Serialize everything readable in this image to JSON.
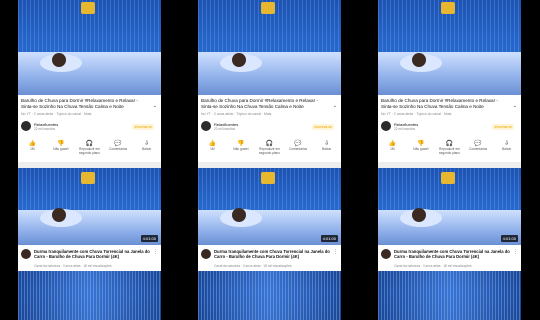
{
  "panels": [
    {
      "video1": {
        "title": "Barulho de Chuva para Dormir #Relaxamento e Relaxar - Sinta-se Sozinho Na Chuva Tensão Calma e Noite",
        "meta": "No YT · 2 anos atrás · Tópico do canal · Mais",
        "channel": "Relaxfluentes",
        "subs": "22 mil inscritos",
        "subscribe": "Inscreva-se"
      },
      "actions": [
        {
          "icon": "like-icon",
          "glyph": "👍",
          "label": "1M"
        },
        {
          "icon": "dislike-icon",
          "glyph": "👎",
          "label": "Não gostei"
        },
        {
          "icon": "headphones-icon",
          "glyph": "🎧",
          "label": "Reproduzir em segundo plano"
        },
        {
          "icon": "comments-icon",
          "glyph": "💬",
          "label": "Comentários"
        },
        {
          "icon": "save-icon",
          "glyph": "⇩",
          "label": "Baixar"
        }
      ],
      "video2": {
        "duration": "4:01:00",
        "title": "Durma tranquilamente com Chuva Torrencial na Janela do Carro - Barulho de Chuva Para Dormir (4K)",
        "meta": "Canal da natureza · 3 anos atrás · 18 mil visualizações"
      }
    },
    {
      "video1": {
        "title": "Barulho de Chuva para Dormir #Relaxamento e Relaxar - Sinta-se Sozinho Na Chuva Tensão Calma e Noite",
        "meta": "No YT · 2 anos atrás · Tópico do canal · Mais",
        "channel": "Relaxfluentes",
        "subs": "22 mil inscritos",
        "subscribe": "Inscreva-se"
      },
      "actions": [
        {
          "icon": "like-icon",
          "glyph": "👍",
          "label": "1M"
        },
        {
          "icon": "dislike-icon",
          "glyph": "👎",
          "label": "Não gostei"
        },
        {
          "icon": "headphones-icon",
          "glyph": "🎧",
          "label": "Reproduzir em segundo plano"
        },
        {
          "icon": "comments-icon",
          "glyph": "💬",
          "label": "Comentários"
        },
        {
          "icon": "save-icon",
          "glyph": "⇩",
          "label": "Baixar"
        }
      ],
      "video2": {
        "duration": "4:01:00",
        "title": "Durma tranquilamente com Chuva Torrencial na Janela do Carro - Barulho de Chuva Para Dormir (4K)",
        "meta": "Canal da natureza · 3 anos atrás · 18 mil visualizações"
      }
    },
    {
      "video1": {
        "title": "Barulho de Chuva para Dormir #Relaxamento e Relaxar - Sinta-se Sozinho Na Chuva Tensão Calma e Noite",
        "meta": "No YT · 2 anos atrás · Tópico do canal · Mais",
        "channel": "Relaxfluentes",
        "subs": "22 mil inscritos",
        "subscribe": "Inscreva-se"
      },
      "actions": [
        {
          "icon": "like-icon",
          "glyph": "👍",
          "label": "1M"
        },
        {
          "icon": "dislike-icon",
          "glyph": "👎",
          "label": "Não gostei"
        },
        {
          "icon": "headphones-icon",
          "glyph": "🎧",
          "label": "Reproduzir em segundo plano"
        },
        {
          "icon": "comments-icon",
          "glyph": "💬",
          "label": "Comentários"
        },
        {
          "icon": "save-icon",
          "glyph": "⇩",
          "label": "Baixar"
        }
      ],
      "video2": {
        "duration": "4:01:00",
        "title": "Durma tranquilamente com Chuva Torrencial na Janela do Carro - Barulho de Chuva Para Dormir (4K)",
        "meta": "Canal da natureza · 3 anos atrás · 18 mil visualizações"
      }
    }
  ],
  "colors": {
    "background": "#000000",
    "accent": "#e7b82f",
    "thumbnail": "#1b4fa8"
  }
}
